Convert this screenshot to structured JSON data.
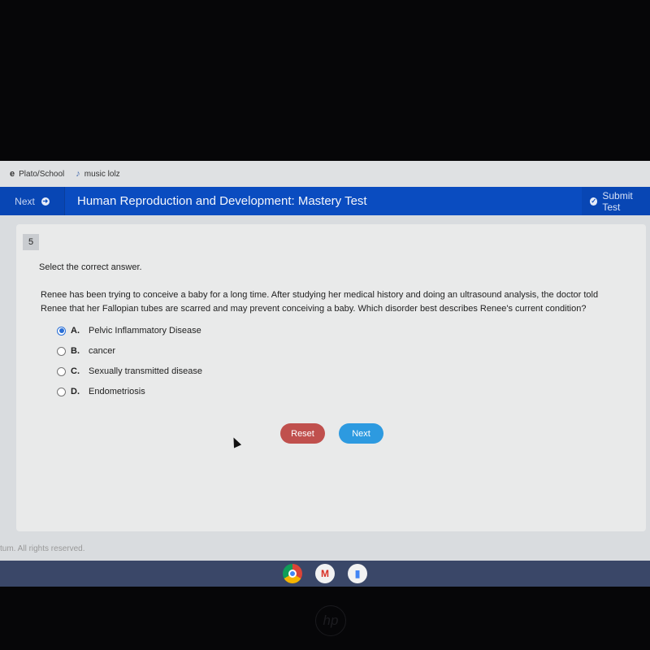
{
  "bookmarks": [
    {
      "label": "Plato/School",
      "icon": "edmentum-icon"
    },
    {
      "label": "music lolz",
      "icon": "music-note-icon"
    }
  ],
  "header": {
    "next_label": "Next",
    "title": "Human Reproduction and Development: Mastery Test",
    "submit_label": "Submit Test",
    "color": "#0a4cc0"
  },
  "question": {
    "number": "5",
    "instruction": "Select the correct answer.",
    "text": "Renee has been trying to conceive a baby for a long time. After studying her medical history and doing an ultrasound analysis, the doctor told Renee that her Fallopian tubes are scarred and may prevent conceiving a baby. Which disorder best describes Renee's current condition?",
    "options": [
      {
        "letter": "A.",
        "text": "Pelvic Inflammatory Disease",
        "selected": true
      },
      {
        "letter": "B.",
        "text": "cancer",
        "selected": false
      },
      {
        "letter": "C.",
        "text": "Sexually transmitted disease",
        "selected": false
      },
      {
        "letter": "D.",
        "text": "Endometriosis",
        "selected": false
      }
    ]
  },
  "buttons": {
    "reset": "Reset",
    "next": "Next"
  },
  "footer": "tum. All rights reserved.",
  "taskbar": [
    "chrome-icon",
    "gmail-icon",
    "docs-icon"
  ],
  "bezel_logo": "hp"
}
